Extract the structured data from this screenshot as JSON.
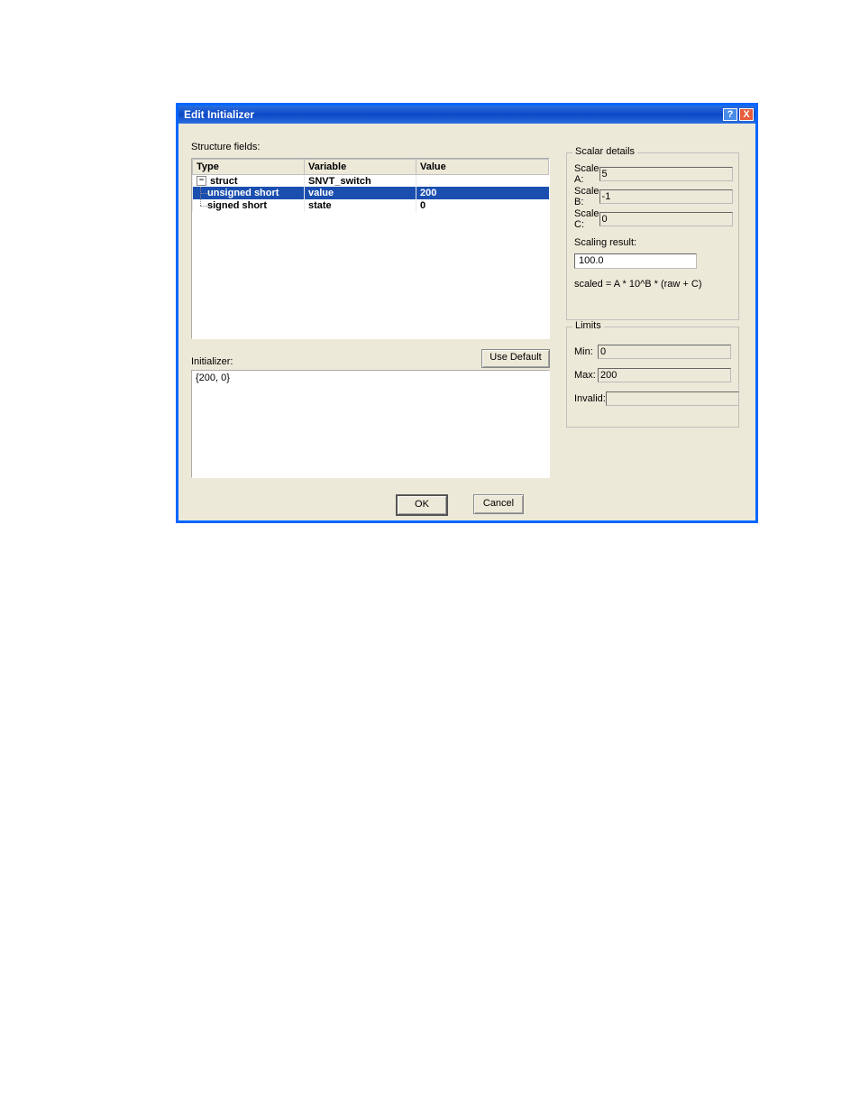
{
  "title": "Edit Initializer",
  "titlebar": {
    "help": "?",
    "close": "X"
  },
  "structure_fields_label": "Structure fields:",
  "table": {
    "headers": {
      "type": "Type",
      "variable": "Variable",
      "value": "Value"
    },
    "rows": [
      {
        "type": "struct",
        "variable": "SNVT_switch",
        "value": "",
        "level": 0,
        "parent": true
      },
      {
        "type": "unsigned short",
        "variable": "value",
        "value": "200",
        "level": 1,
        "selected": true
      },
      {
        "type": "signed short",
        "variable": "state",
        "value": "0",
        "level": 1,
        "last": true
      }
    ]
  },
  "initializer_label": "Initializer:",
  "initializer_value": "{200, 0}",
  "use_default_label": "Use Default",
  "scalar": {
    "title": "Scalar details",
    "scale_a_label": "Scale A:",
    "scale_a": "5",
    "scale_b_label": "Scale B:",
    "scale_b": "-1",
    "scale_c_label": "Scale C:",
    "scale_c": "0",
    "result_label": "Scaling result:",
    "result": "100.0",
    "formula": "scaled = A * 10^B * (raw + C)"
  },
  "limits": {
    "title": "Limits",
    "min_label": "Min:",
    "min": "0",
    "max_label": "Max:",
    "max": "200",
    "invalid_label": "Invalid:",
    "invalid": ""
  },
  "ok_label": "OK",
  "cancel_label": "Cancel"
}
